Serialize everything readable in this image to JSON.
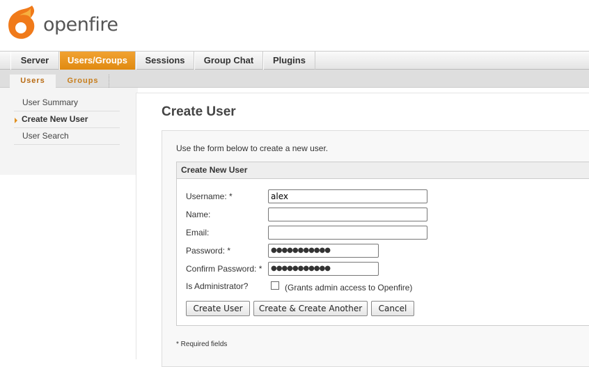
{
  "logo": {
    "text": "openfire",
    "brand_color": "#f07a1a"
  },
  "nav": {
    "tabs": [
      {
        "label": "Server"
      },
      {
        "label": "Users/Groups",
        "active": true
      },
      {
        "label": "Sessions"
      },
      {
        "label": "Group Chat"
      },
      {
        "label": "Plugins"
      }
    ],
    "accent": "#e8941e"
  },
  "subnav": {
    "tabs": [
      {
        "label": "Users",
        "active": true
      },
      {
        "label": "Groups"
      }
    ]
  },
  "sidebar": {
    "items": [
      {
        "label": "User Summary"
      },
      {
        "label": "Create New User",
        "active": true
      },
      {
        "label": "User Search"
      }
    ]
  },
  "page": {
    "title": "Create User",
    "intro": "Use the form below to create a new user.",
    "required_note": "* Required fields"
  },
  "form": {
    "title": "Create New User",
    "username": {
      "label": "Username: *",
      "value": "alex"
    },
    "name": {
      "label": "Name:",
      "value": ""
    },
    "email": {
      "label": "Email:",
      "value": ""
    },
    "password": {
      "label": "Password: *",
      "value": "●●●●●●●●●●●"
    },
    "confirm": {
      "label": "Confirm Password: *",
      "value": "●●●●●●●●●●●"
    },
    "admin": {
      "label": "Is Administrator?",
      "checked": false,
      "hint": "(Grants admin access to Openfire)"
    },
    "buttons": {
      "create": "Create User",
      "create_another": "Create & Create Another",
      "cancel": "Cancel"
    }
  }
}
